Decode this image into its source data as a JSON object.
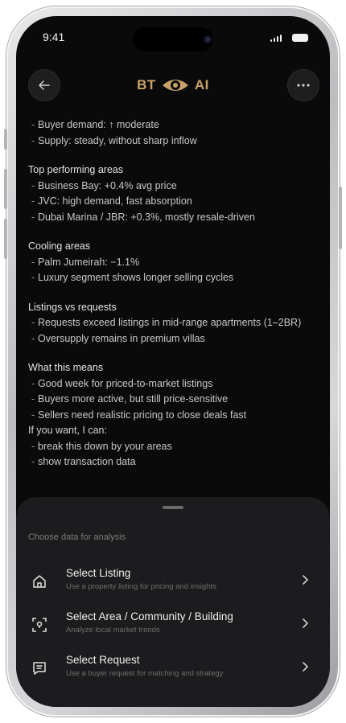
{
  "status": {
    "time": "9:41"
  },
  "header": {
    "logo_left": "BT",
    "logo_right": "AI"
  },
  "content": {
    "intro_bullets": [
      "Buyer demand: ↑ moderate",
      "Supply: steady, without sharp inflow"
    ],
    "sections": [
      {
        "heading": "Top performing areas",
        "items": [
          "Business Bay: +0.4% avg price",
          "JVC: high demand, fast absorption",
          "Dubai Marina / JBR: +0.3%, mostly resale-driven"
        ]
      },
      {
        "heading": "Cooling areas",
        "items": [
          "Palm Jumeirah: −1.1%",
          "Luxury segment shows longer selling cycles"
        ]
      },
      {
        "heading": "Listings vs requests",
        "items": [
          "Requests exceed listings in mid-range apartments (1–2BR)",
          "Oversupply remains in premium villas"
        ]
      }
    ],
    "meaning": {
      "heading": "What this means",
      "items": [
        "Good week for priced-to-market listings",
        "Buyers more active, but still price-sensitive",
        "Sellers need realistic pricing to close deals fast"
      ]
    },
    "offer": {
      "heading": "If you want, I can:",
      "items": [
        "break this down by your areas",
        "show transaction data"
      ]
    }
  },
  "sheet": {
    "title": "Choose data for analysis",
    "options": [
      {
        "icon": "home-icon",
        "title": "Select Listing",
        "subtitle": "Use a property listing for pricing and insights"
      },
      {
        "icon": "location-scan-icon",
        "title": "Select Area / Community / Building",
        "subtitle": "Analyze local market trends"
      },
      {
        "icon": "message-icon",
        "title": "Select Request",
        "subtitle": "Use a buyer request for matching and strategy"
      }
    ]
  }
}
